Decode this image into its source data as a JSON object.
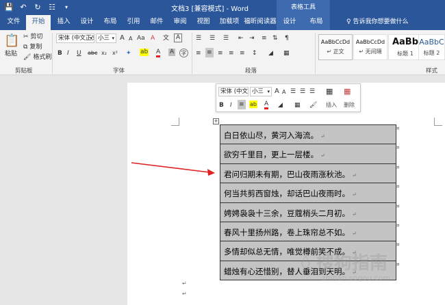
{
  "titlebar": {
    "save_icon": "floppy-save-icon",
    "undo_icon": "undo-icon",
    "redo_icon": "repeat-icon",
    "preview_icon": "print-preview-icon",
    "customize_icon": "qat-customize-icon",
    "title": "文档3 [兼容模式] - Word",
    "context_tools": "表格工具"
  },
  "tabs": [
    {
      "label": "文件"
    },
    {
      "label": "开始"
    },
    {
      "label": "插入"
    },
    {
      "label": "设计"
    },
    {
      "label": "布局"
    },
    {
      "label": "引用"
    },
    {
      "label": "邮件"
    },
    {
      "label": "审阅"
    },
    {
      "label": "视图"
    },
    {
      "label": "加载项"
    },
    {
      "label": "福昕阅读器"
    },
    {
      "label": "设计"
    },
    {
      "label": "布局"
    }
  ],
  "tellme": "♀ 告诉我你想要做什么",
  "clipboard": {
    "paste": "粘贴",
    "cut": "剪切",
    "copy": "复制",
    "format_painter": "格式刷",
    "label": "剪贴板"
  },
  "font": {
    "name": "宋体 (中文正文)",
    "size": "小三",
    "label": "字体",
    "bold": "B",
    "italic": "I",
    "underline": "U",
    "strike": "abc",
    "subscript": "x₂",
    "superscript": "x²",
    "grow": "A",
    "shrink": "A",
    "case": "Aa",
    "clear": "A",
    "pinyin": "文",
    "border_char": "A",
    "highlight": "ab",
    "color": "A",
    "shade": "A",
    "circle": "字"
  },
  "paragraph": {
    "label": "段落"
  },
  "styles": {
    "label": "样式",
    "items": [
      {
        "sample": "AaBbCcDd",
        "name": "↵ 正文"
      },
      {
        "sample": "AaBbCcDd",
        "name": "↵ 无间隔"
      },
      {
        "sample": "AaBb",
        "name": "标题 1"
      },
      {
        "sample": "AaBbC",
        "name": "标题 2"
      }
    ]
  },
  "minibar": {
    "font": "宋体 (中文",
    "size": "小三",
    "bold": "B",
    "italic": "I",
    "insert": "插入",
    "delete": "删除"
  },
  "table_rows": [
    "白日依山尽，黄河入海流。",
    "欲穷千里目，更上一层楼。",
    "君问归期未有期，巴山夜雨涨秋池。",
    "何当共剪西窗烛，却话巴山夜雨时。",
    "娉娉袅袅十三余，豆蔻梢头二月初。",
    "春风十里扬州路，卷上珠帘总不如。",
    "多情却似总无情，唯觉樽前笑不成。",
    "蜡烛有心还惜别，替人垂泪到天明。"
  ],
  "para_mark": "↵",
  "table_handle": "+",
  "watermark": {
    "text": "搜狗指南",
    "sub": "zhinan.sogou.com"
  },
  "colors": {
    "title_bar": "#2b579a",
    "ribbon": "#f3f3f3",
    "table_fill": "#c4c4c4",
    "arrow": "#e02020"
  }
}
